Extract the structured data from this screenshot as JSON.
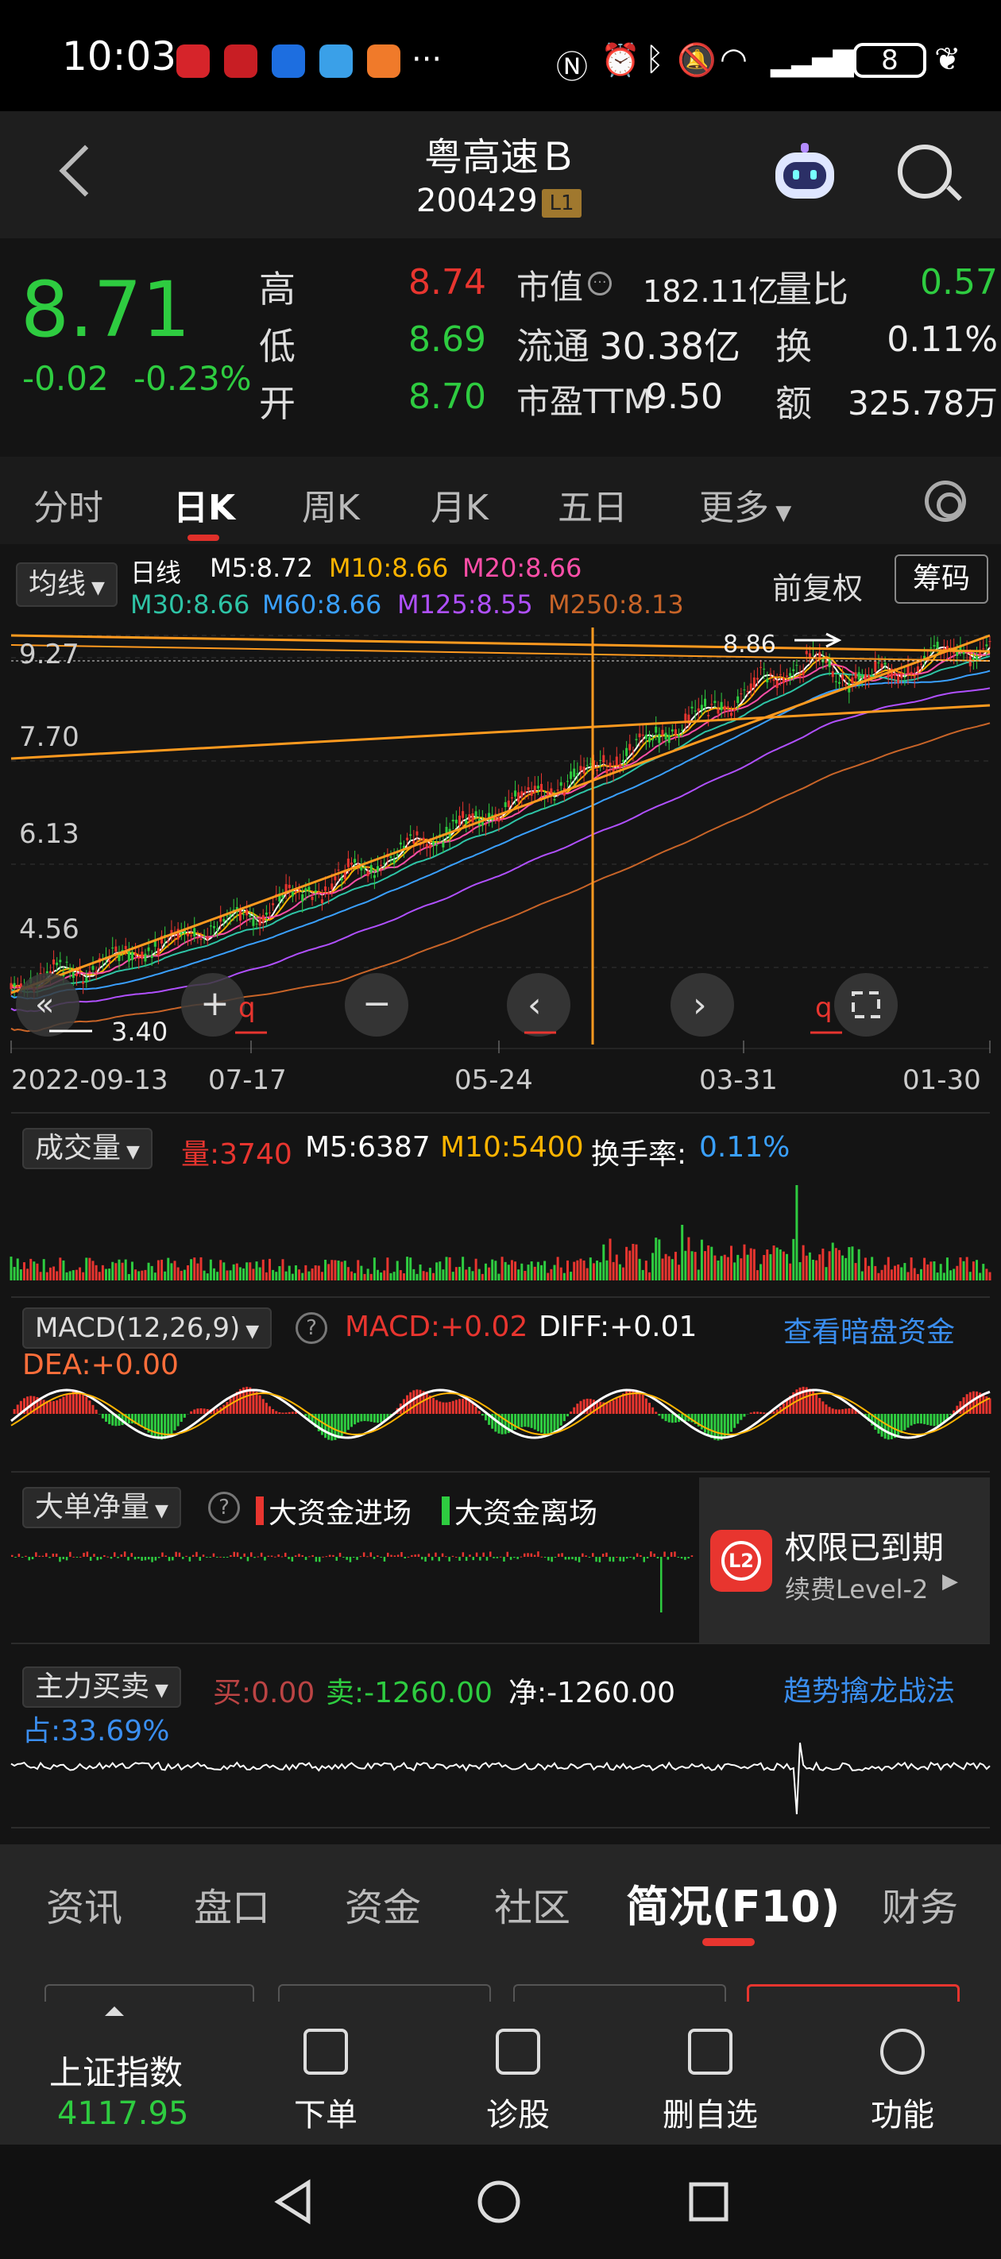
{
  "status": {
    "time": "10:03",
    "dots": "···",
    "battery": "8"
  },
  "header": {
    "title": "粤高速Ｂ",
    "code": "200429",
    "level": "L1"
  },
  "quote": {
    "price": "8.71",
    "change": "-0.02",
    "change_pct": "-0.23%",
    "high_label": "高",
    "high": "8.74",
    "low_label": "低",
    "low": "8.69",
    "open_label": "开",
    "open": "8.70",
    "mktcap_label": "市值",
    "mktcap": "182.11亿",
    "float_label": "流通",
    "float": "30.38亿",
    "pe_label": "市盈TTM",
    "pe": "9.50",
    "vr_label": "量比",
    "vr": "0.57",
    "turn_label": "换",
    "turn": "0.11%",
    "amt_label": "额",
    "amt": "325.78万"
  },
  "ktabs": [
    "分时",
    "日K",
    "周K",
    "月K",
    "五日",
    "更多"
  ],
  "chart": {
    "ma_dropdown": "均线",
    "period": "日线",
    "m5": "M5:8.72",
    "m10": "M10:8.66",
    "m20": "M20:8.66",
    "m30": "M30:8.66",
    "m60": "M60:8.66",
    "m125": "M125:8.55",
    "m250": "M250:8.13",
    "adjust": "前复权",
    "chips": "筹码",
    "y_ticks": [
      "9.27",
      "7.70",
      "6.13",
      "4.56"
    ],
    "max_label": "8.86",
    "min_label": "3.40",
    "x_ticks": [
      "2022-09-13",
      "07-17",
      "05-24",
      "03-31",
      "01-30"
    ]
  },
  "volume": {
    "dropdown": "成交量",
    "vol": "量:3740",
    "m5": "M5:6387",
    "m10": "M10:5400",
    "turn_label": "换手率:",
    "turn": "0.11%"
  },
  "macd": {
    "dropdown": "MACD(12,26,9)",
    "macd": "MACD:+0.02",
    "diff": "DIFF:+0.01",
    "dea": "DEA:+0.00",
    "link": "查看暗盘资金"
  },
  "bigorder": {
    "dropdown": "大单净量",
    "in": "大资金进场",
    "out": "大资金离场",
    "locked_title": "权限已到期",
    "locked_sub": "续费Level-2",
    "l2": "L2"
  },
  "mainflow": {
    "dropdown": "主力买卖",
    "buy": "买:0.00",
    "sell": "卖:-1260.00",
    "net": "净:-1260.00",
    "link": "趋势擒龙战法",
    "share": "占:33.69%"
  },
  "bottom_tabs": [
    "资讯",
    "盘口",
    "资金",
    "社区",
    "简况(F10)",
    "财务"
  ],
  "dock": {
    "index_name": "上证指数",
    "index_value": "4117.95",
    "items": [
      "下单",
      "诊股",
      "删自选",
      "功能"
    ]
  },
  "colors": {
    "up": "#e8352f",
    "down": "#2ecc40",
    "m5": "#ffffff",
    "m10": "#ffb400",
    "m20": "#ff4fa8",
    "m30": "#2ec4a6",
    "m60": "#3aa0ff",
    "m125": "#b050ff",
    "m250": "#c86428",
    "trend": "#ff9a1f",
    "link": "#3a8ef0"
  }
}
